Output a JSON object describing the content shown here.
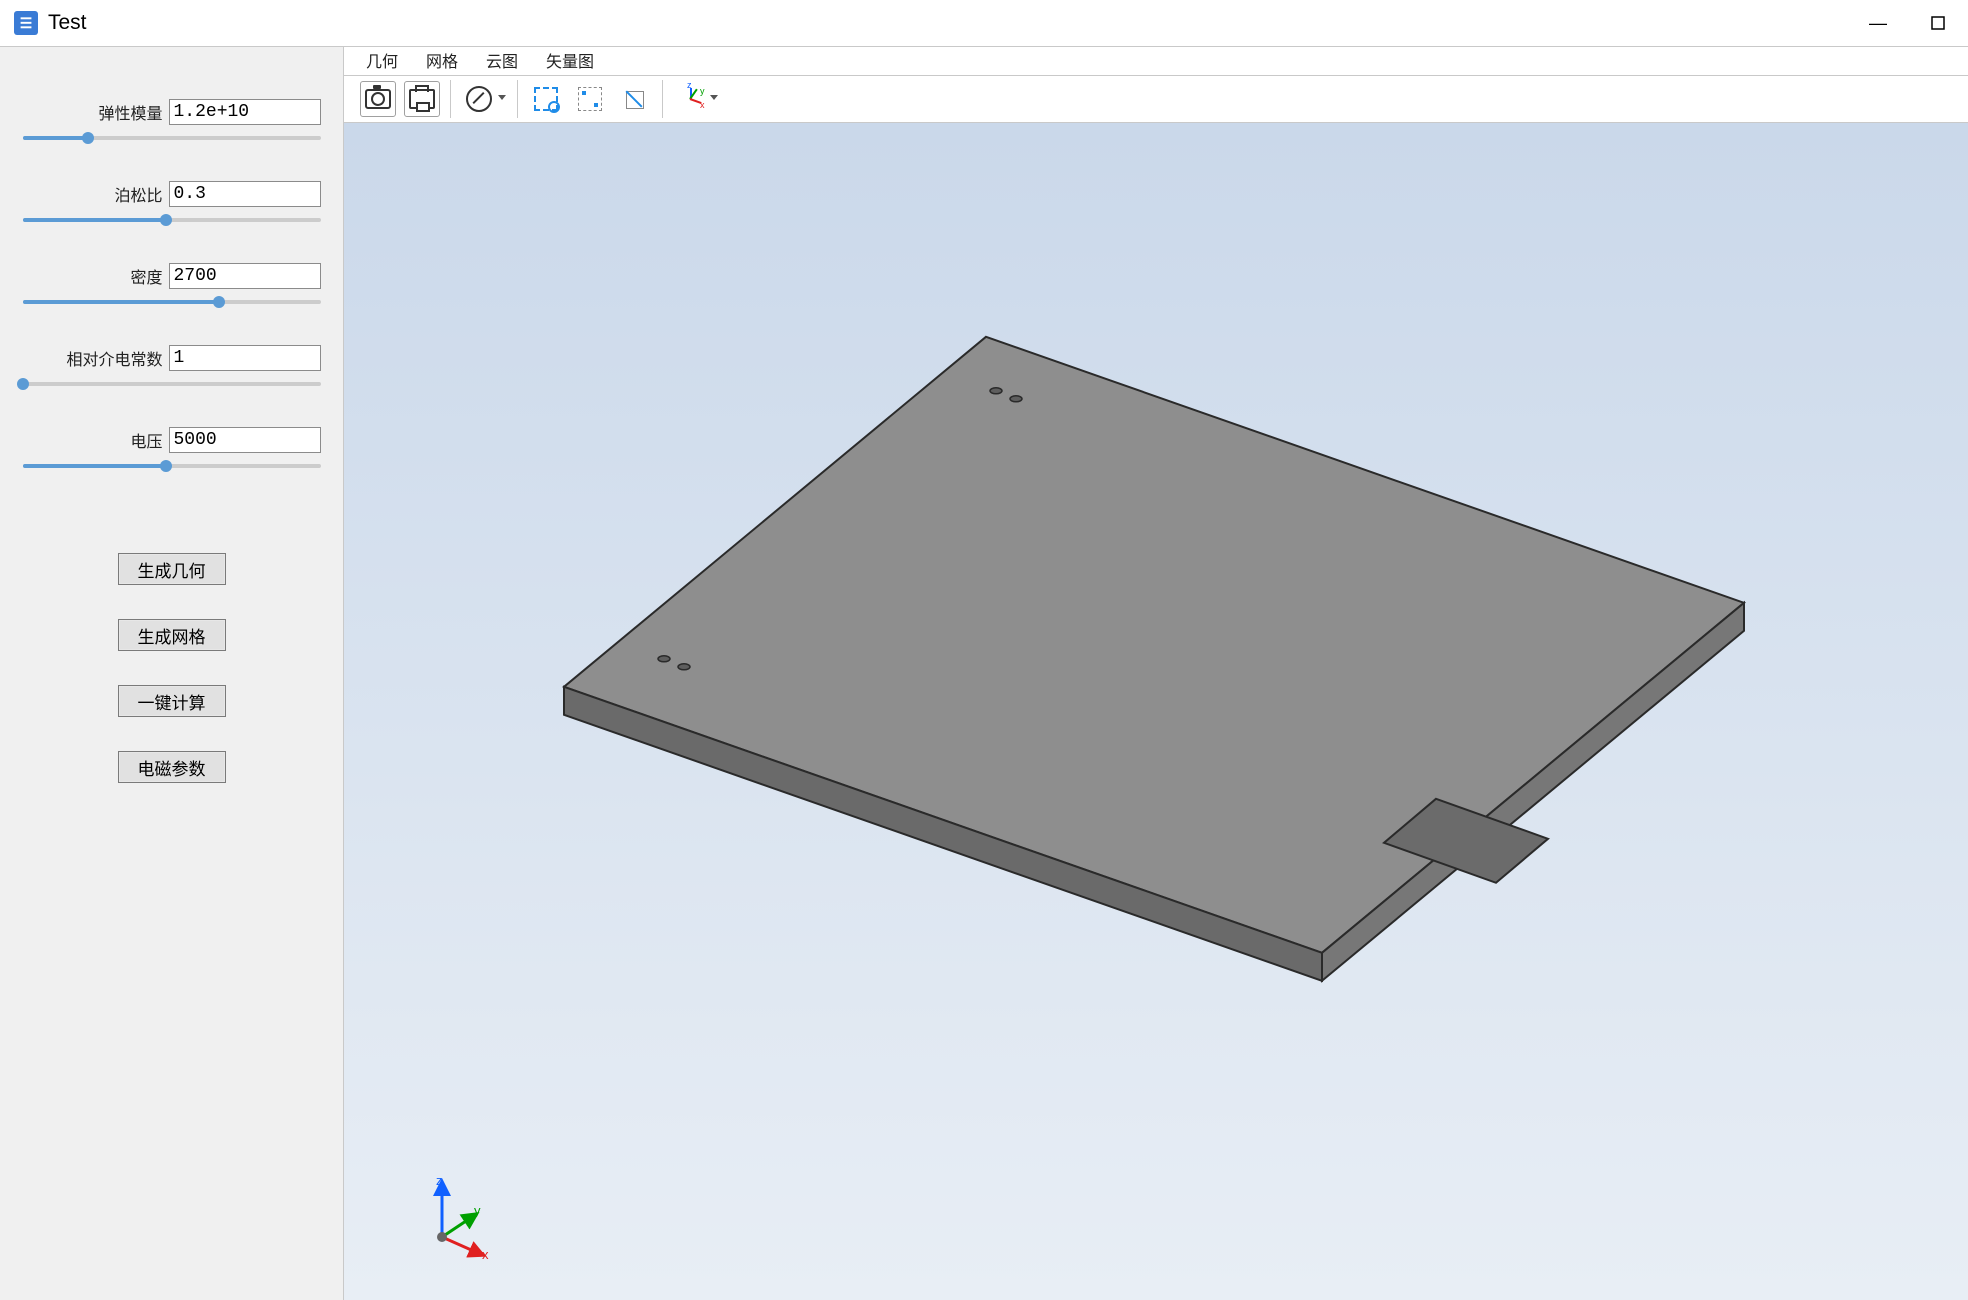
{
  "window": {
    "title": "Test",
    "minimize": "—"
  },
  "tabs": {
    "items": [
      "几何",
      "网格",
      "云图",
      "矢量图"
    ]
  },
  "toolbar": {
    "camera": "snapshot-icon",
    "print": "print-icon",
    "forbid": "clear-scene-icon",
    "boxsel": "box-select-icon",
    "fitpts": "fit-points-icon",
    "expand": "zoom-extents-icon",
    "axis": "axis-orientation-icon",
    "axis_labels": {
      "x": "x",
      "y": "y",
      "z": "z"
    }
  },
  "params": {
    "elastic_modulus": {
      "label": "弹性模量",
      "value": "1.2e+10",
      "slider_pct": 22
    },
    "poisson_ratio": {
      "label": "泊松比",
      "value": "0.3",
      "slider_pct": 48
    },
    "density": {
      "label": "密度",
      "value": "2700",
      "slider_pct": 66
    },
    "rel_permittivity": {
      "label": "相对介电常数",
      "value": "1",
      "slider_pct": 0
    },
    "voltage": {
      "label": "电压",
      "value": "5000",
      "slider_pct": 48
    }
  },
  "buttons": {
    "gen_geometry": "生成几何",
    "gen_mesh": "生成网格",
    "oneclick_calc": "一键计算",
    "em_params": "电磁参数"
  },
  "triad": {
    "x": "x",
    "y": "y",
    "z": "z"
  }
}
